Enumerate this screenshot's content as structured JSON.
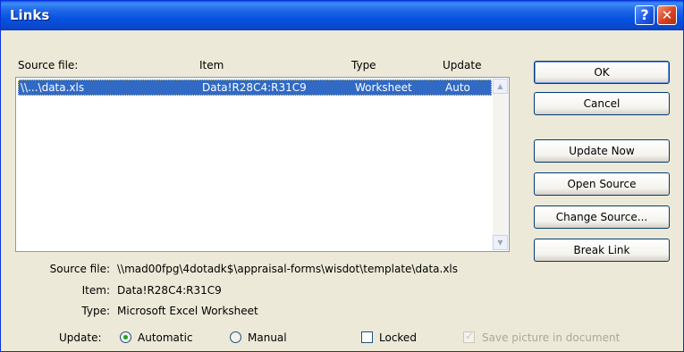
{
  "window": {
    "title": "Links",
    "help_glyph": "?",
    "close_glyph": "✕"
  },
  "list": {
    "headers": [
      "Source file:",
      "Item",
      "Type",
      "Update"
    ],
    "rows": [
      {
        "source": "\\\\...\\data.xls",
        "item": "Data!R28C4:R31C9",
        "type": "Worksheet",
        "update": "Auto"
      }
    ]
  },
  "buttons": {
    "ok": "OK",
    "cancel": "Cancel",
    "update_now": "Update Now",
    "open_source": "Open Source",
    "change_source": "Change Source...",
    "break_link": "Break Link"
  },
  "details": {
    "source_label": "Source file:",
    "source_value": "\\\\mad00fpg\\4dotadk$\\appraisal-forms\\wisdot\\template\\data.xls",
    "item_label": "Item:",
    "item_value": "Data!R28C4:R31C9",
    "type_label": "Type:",
    "type_value": "Microsoft Excel Worksheet"
  },
  "options": {
    "update_label": "Update:",
    "automatic": "Automatic",
    "manual": "Manual",
    "locked": "Locked",
    "save_picture": "Save picture in document",
    "update_mode": "Automatic",
    "locked_checked": false,
    "save_picture_checked": true
  }
}
